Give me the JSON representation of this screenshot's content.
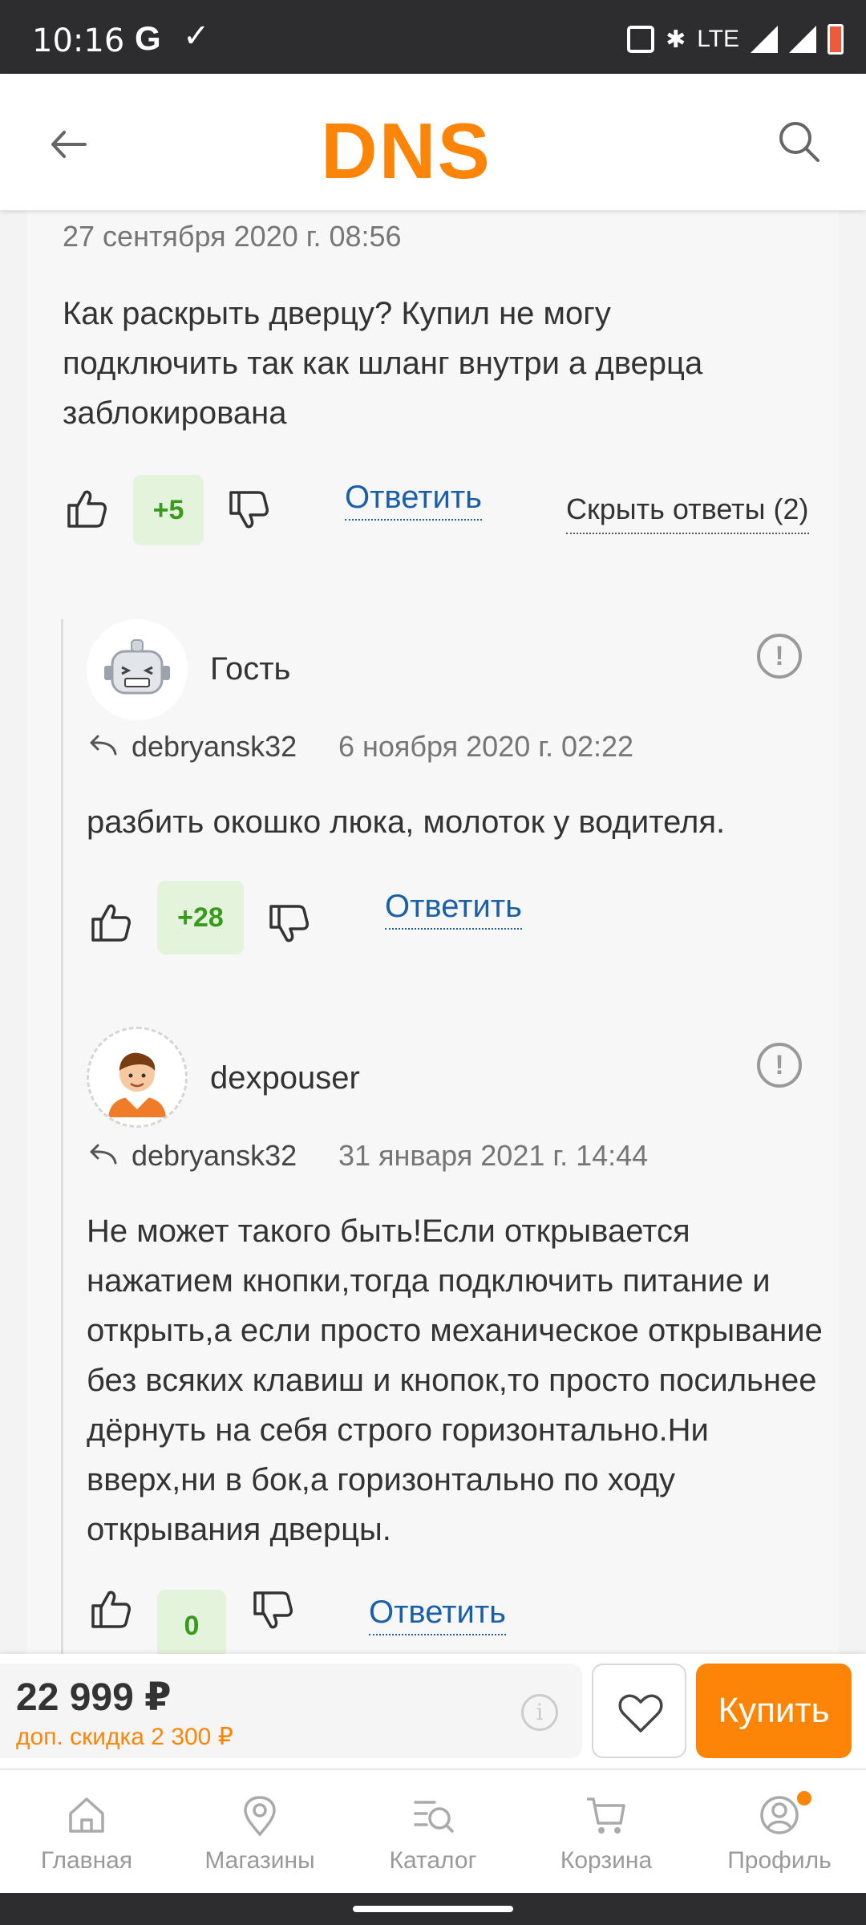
{
  "status_bar": {
    "time": "10:16",
    "g_label": "G",
    "network": "LTE"
  },
  "header": {
    "logo": "DNS"
  },
  "question": {
    "date": "27 сентября 2020 г. 08:56",
    "text": "Как раскрыть дверцу? Купил не могу подключить так как шланг внутри а дверца заблокирована",
    "votes": "+5",
    "reply_label": "Ответить",
    "hide_replies_label": "Скрыть ответы (2)"
  },
  "replies": [
    {
      "author": "Гость",
      "reply_to": "debryansk32",
      "date": "6 ноября 2020 г. 02:22",
      "text": "разбить окошко люка, молоток у водителя.",
      "votes": "+28",
      "reply_label": "Ответить",
      "report_symbol": "!"
    },
    {
      "author": "dexpouser",
      "reply_to": "debryansk32",
      "date": "31 января 2021 г. 14:44",
      "text": "Не может такого быть!Если открывается нажатием кнопки,тогда подключить питание и открыть,а если просто механическое открывание без всяких клавиш и кнопок,то просто посильнее дёрнуть на себя строго горизонтально.Ни вверх,ни в бок,а горизонтально по ходу открывания дверцы.",
      "votes": "0",
      "reply_label": "Ответить",
      "report_symbol": "!"
    }
  ],
  "buy_bar": {
    "price": "22 999 ₽",
    "discount": "доп. скидка 2 300 ₽",
    "info_symbol": "i",
    "buy_label": "Купить"
  },
  "bottom_nav": {
    "items": [
      {
        "label": "Главная",
        "icon": "home-icon"
      },
      {
        "label": "Магазины",
        "icon": "map-pin-icon"
      },
      {
        "label": "Каталог",
        "icon": "catalog-search-icon"
      },
      {
        "label": "Корзина",
        "icon": "cart-icon"
      },
      {
        "label": "Профиль",
        "icon": "profile-icon"
      }
    ]
  },
  "colors": {
    "brand": "#fc8507",
    "link": "#1a5fa8",
    "vote_positive": "#3a9a1e",
    "vote_bg": "#e4f3dc"
  }
}
